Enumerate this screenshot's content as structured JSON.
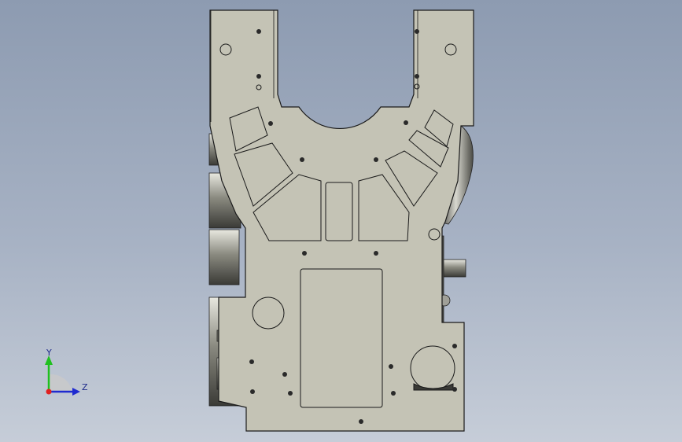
{
  "viewport": {
    "background_top": "#8d9bb1",
    "background_bottom": "#c6cdd8",
    "part_fill": "#c4c3b5",
    "part_edge": "#1a1a1a"
  },
  "triad": {
    "y_label": "Y",
    "z_label": "Z",
    "y_color": "#20c020",
    "z_color": "#1e2ad0",
    "x_color": "#e02020"
  }
}
